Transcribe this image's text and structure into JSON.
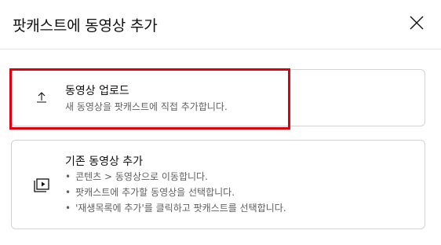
{
  "dialog": {
    "title": "팟캐스트에 동영상 추가",
    "close_icon": "close-icon"
  },
  "options": {
    "upload": {
      "icon": "upload-icon",
      "title": "동영상 업로드",
      "description": "새 동영상을 팟캐스트에 직접 추가합니다."
    },
    "existing": {
      "icon": "playlist-play-icon",
      "title": "기존 동영상 추가",
      "steps": [
        "콘텐츠 > 동영상으로 이동합니다.",
        "팟캐스트에 추가할 동영상을 선택합니다.",
        "'재생목록에 추가'를 클릭하고 팟캐스트를 선택합니다."
      ]
    }
  },
  "colors": {
    "highlight": "#e0000e",
    "border": "#d3d3d3",
    "secondary_text": "#606060"
  }
}
